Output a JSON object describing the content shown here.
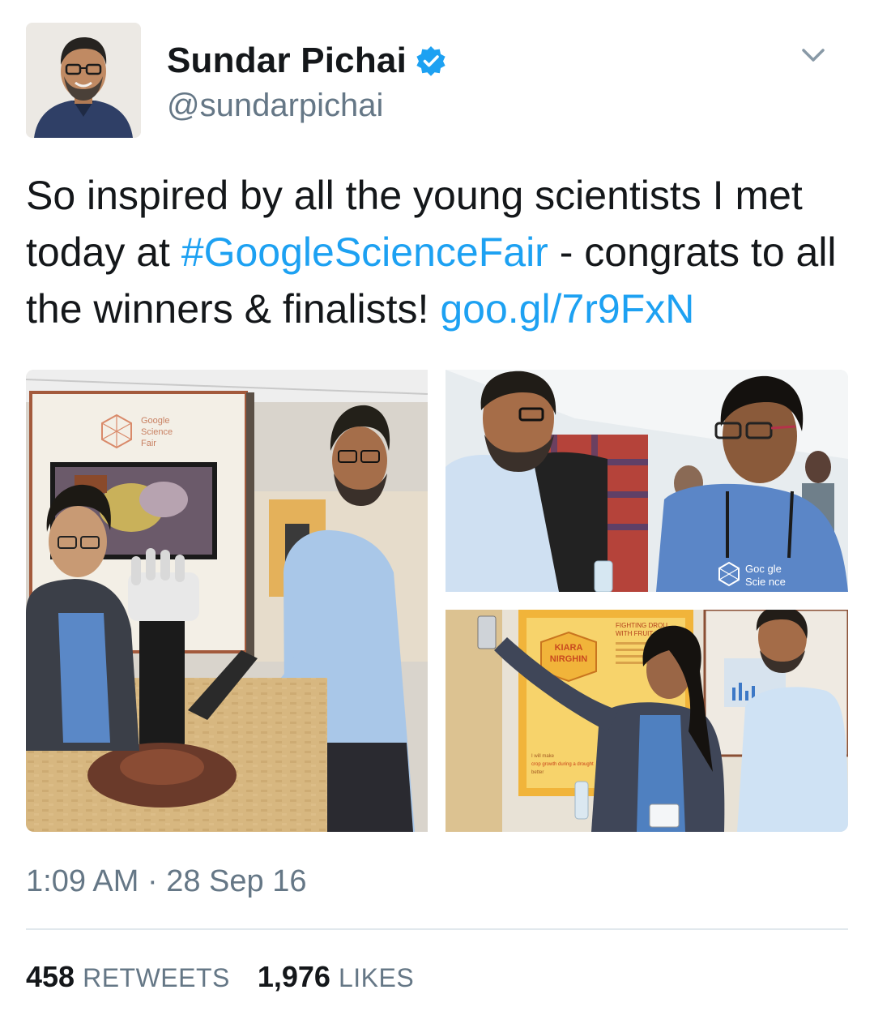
{
  "author": {
    "display_name": "Sundar Pichai",
    "handle": "@sundarpichai",
    "verified": true,
    "verified_color": "#1da1f2"
  },
  "tweet": {
    "text_part1": "So inspired by all the young scientists I met today at ",
    "hashtag": "#GoogleScienceFair",
    "text_part2": " - congrats to all the winners & finalists! ",
    "link": "goo.gl/7r9FxN",
    "link_color": "#1da1f2"
  },
  "media": {
    "photos": [
      {
        "label": "Google Science Fair",
        "name_tag": "KIARA NIRGHIN"
      }
    ],
    "booth_logo": {
      "line1": "Google",
      "line2": "Science",
      "line3": "Fair"
    },
    "shirt_logo": {
      "line1": "Goc gle",
      "line2": "Scie nce"
    },
    "booth_sign": {
      "name_line1": "KIARA",
      "name_line2": "NIRGHIN",
      "header_line1": "FIGHTING DROU",
      "header_line2": "WITH FRUIT",
      "caption1": "I will make",
      "caption2": "crop growth during a drought",
      "caption3": "better"
    }
  },
  "meta": {
    "time": "1:09 AM",
    "separator": " · ",
    "date": "28 Sep 16"
  },
  "stats": {
    "retweets_count": "458",
    "retweets_label": "RETWEETS",
    "likes_count": "1,976",
    "likes_label": "LIKES"
  },
  "icons": {
    "verified": "verified-badge-icon",
    "caret": "chevron-down-icon"
  }
}
